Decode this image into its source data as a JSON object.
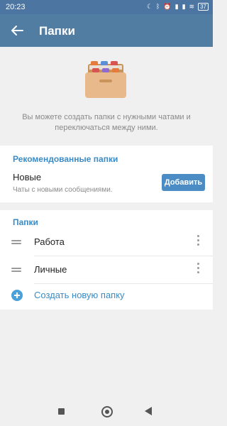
{
  "status_bar": {
    "time": "20:23",
    "battery": "37"
  },
  "header": {
    "title": "Папки"
  },
  "hero": {
    "description": "Вы можете создать папки с нужными чатами и переключаться между ними."
  },
  "recommended": {
    "section_title": "Рекомендованные папки",
    "item_name": "Новые",
    "item_description": "Чаты с новыми сообщениями.",
    "add_label": "Добавить"
  },
  "folders": {
    "section_title": "Папки",
    "items": [
      {
        "label": "Работа"
      },
      {
        "label": "Личные"
      }
    ],
    "create_label": "Создать новую папку"
  },
  "colors": {
    "app_bar": "#527da3",
    "accent": "#3a8bc6",
    "button": "#4c8cc4"
  }
}
